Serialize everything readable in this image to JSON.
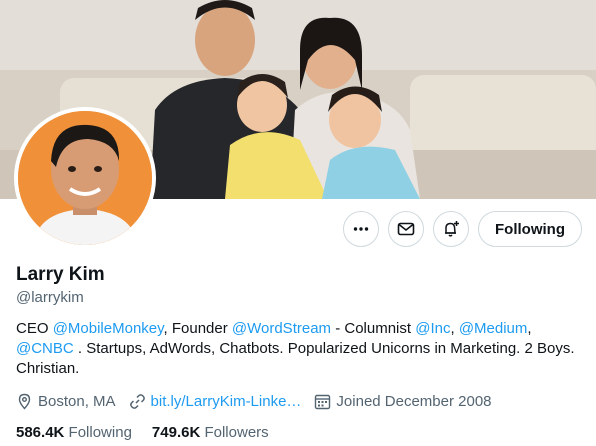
{
  "profile": {
    "name": "Larry Kim",
    "handle": "@larrykim",
    "following_label": "Following"
  },
  "bio": {
    "p1": "CEO ",
    "m1": "@MobileMonkey",
    "p2": ", Founder ",
    "m2": "@WordStream",
    "p3": " - Columnist ",
    "m3": "@Inc",
    "p4": ", ",
    "m4": "@Medium",
    "p5": ", ",
    "m5": "@CNBC",
    "p6": " . Startups, AdWords, Chatbots. Popularized Unicorns in Marketing. 2 Boys. Christian."
  },
  "meta": {
    "location": "Boston, MA",
    "website": "bit.ly/LarryKim-Linke…",
    "joined": "Joined December 2008"
  },
  "stats": {
    "following_count": "586.4K",
    "following_label": "Following",
    "followers_count": "749.6K",
    "followers_label": "Followers"
  },
  "icons": {
    "more": "more-icon",
    "message": "message-icon",
    "notify": "bell-plus-icon",
    "location": "location-pin-icon",
    "link": "link-icon",
    "calendar": "calendar-icon"
  },
  "colors": {
    "accent": "#1d9bf0",
    "secondary_text": "#536471",
    "avatar_bg": "#f0913a"
  }
}
